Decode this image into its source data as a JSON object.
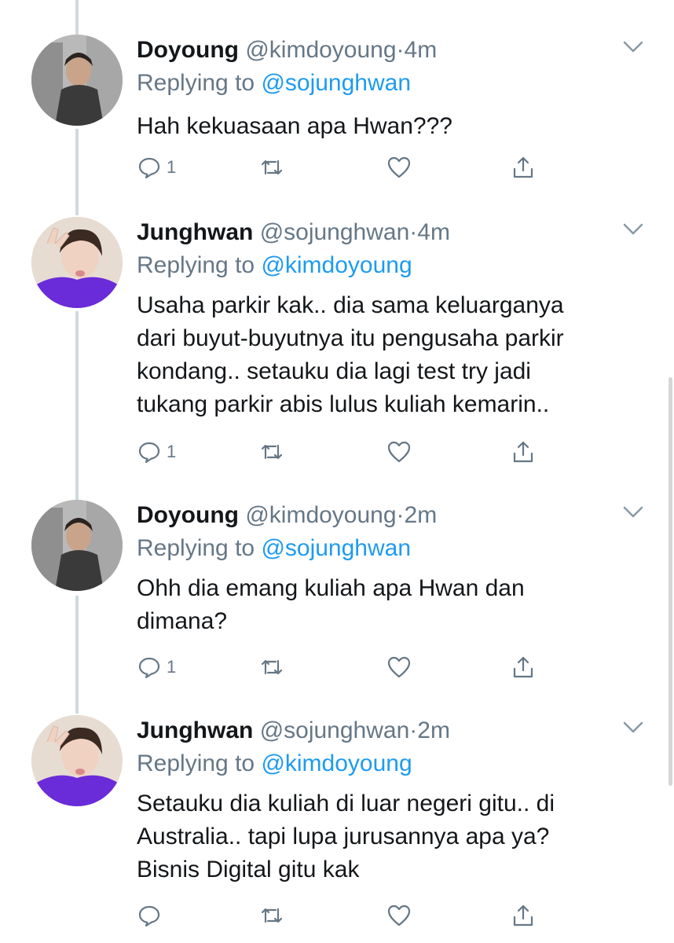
{
  "colors": {
    "link": "#1d9bf0",
    "muted": "#657786",
    "text": "#14171a",
    "thread_line": "#cfd9de"
  },
  "tweets": [
    {
      "name": "Doyoung",
      "handle": "@kimdoyoung",
      "dot": "·",
      "time": "4m",
      "replying_label": "Replying to",
      "replying_to": "@sojunghwan",
      "lines": [
        "Hah kekuasaan apa Hwan???"
      ],
      "reply_count": "1",
      "avatar": "doyoung-avatar"
    },
    {
      "name": "Junghwan",
      "handle": "@sojunghwan",
      "dot": "·",
      "time": "4m",
      "replying_label": "Replying to",
      "replying_to": "@kimdoyoung",
      "lines": [
        "Usaha parkir kak.. dia sama keluarganya",
        "dari buyut-buyutnya itu pengusaha parkir",
        "kondang.. setauku dia lagi test try jadi",
        "tukang parkir abis lulus kuliah kemarin.."
      ],
      "reply_count": "1",
      "avatar": "junghwan-avatar"
    },
    {
      "name": "Doyoung",
      "handle": "@kimdoyoung",
      "dot": "·",
      "time": "2m",
      "replying_label": "Replying to",
      "replying_to": "@sojunghwan",
      "lines": [
        "Ohh dia emang kuliah apa Hwan dan",
        "dimana?"
      ],
      "reply_count": "1",
      "avatar": "doyoung-avatar"
    },
    {
      "name": "Junghwan",
      "handle": "@sojunghwan",
      "dot": "·",
      "time": "2m",
      "replying_label": "Replying to",
      "replying_to": "@kimdoyoung",
      "lines": [
        "Setauku dia kuliah di luar negeri gitu.. di",
        "Australia.. tapi lupa jurusannya apa ya?",
        "Bisnis Digital gitu kak"
      ],
      "reply_count": "",
      "avatar": "junghwan-avatar"
    }
  ]
}
